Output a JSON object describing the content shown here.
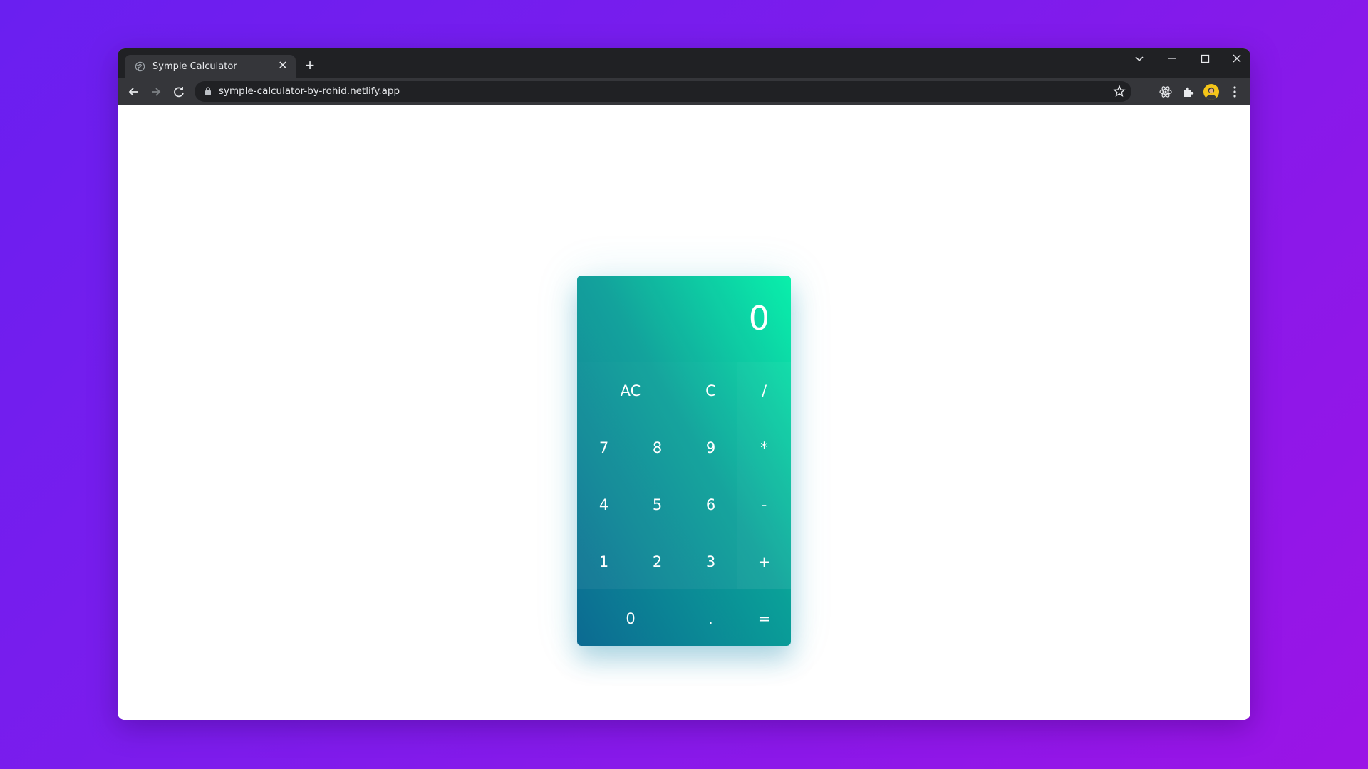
{
  "browser": {
    "tab": {
      "title": "Symple Calculator",
      "close_icon": "close-icon"
    },
    "new_tab_label": "+",
    "address": {
      "url": "symple-calculator-by-rohid.netlify.app"
    },
    "window_controls": [
      "tab-search",
      "minimize",
      "maximize",
      "close"
    ],
    "toolbar_icons": [
      "bookmark-star-icon",
      "react-extension-icon",
      "extensions-puzzle-icon",
      "profile-avatar",
      "menu-kebab-icon"
    ]
  },
  "calculator": {
    "display_value": "0",
    "keys": {
      "ac": "AC",
      "c": "C",
      "divide": "/",
      "seven": "7",
      "eight": "8",
      "nine": "9",
      "multiply": "*",
      "four": "4",
      "five": "5",
      "six": "6",
      "subtract": "-",
      "one": "1",
      "two": "2",
      "three": "3",
      "add": "+",
      "zero": "0",
      "decimal": ".",
      "equals": "="
    }
  },
  "colors": {
    "background_start": "#6a1ff0",
    "background_end": "#9b14e6",
    "calc_gradient_top": "#00f0a8",
    "calc_gradient_bottom": "#0c6a92",
    "browser_chrome": "#202124"
  }
}
